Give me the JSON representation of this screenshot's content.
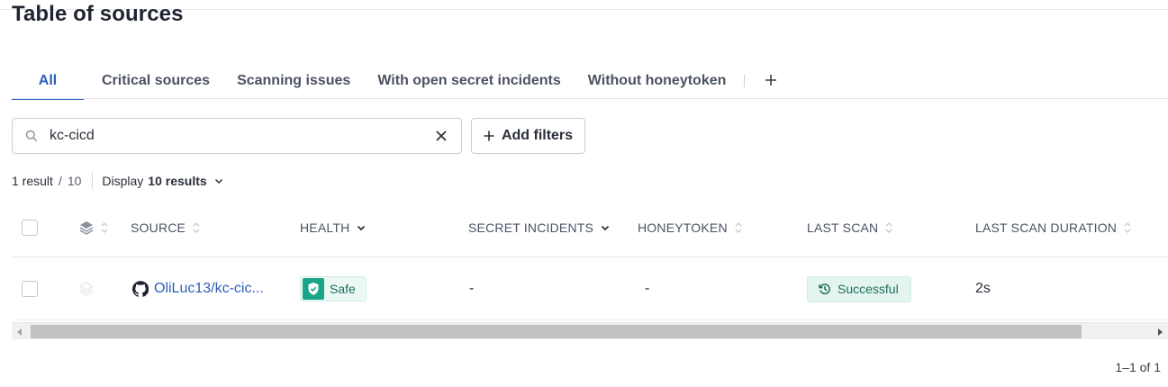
{
  "page": {
    "title": "Table of sources"
  },
  "tabs": [
    {
      "label": "All",
      "active": true
    },
    {
      "label": "Critical sources",
      "active": false
    },
    {
      "label": "Scanning issues",
      "active": false
    },
    {
      "label": "With open secret incidents",
      "active": false
    },
    {
      "label": "Without honeytoken",
      "active": false
    }
  ],
  "search": {
    "value": "kc-cicd",
    "placeholder": "Search"
  },
  "filters": {
    "add_label": "Add filters"
  },
  "results": {
    "count": "1 result",
    "separator": "/",
    "total": "10",
    "display_label": "Display",
    "display_value": "10 results"
  },
  "table": {
    "columns": [
      "SOURCE",
      "HEALTH",
      "SECRET INCIDENTS",
      "HONEYTOKEN",
      "LAST SCAN",
      "LAST SCAN DURATION"
    ],
    "rows": [
      {
        "source": "OliLuc13/kc-cic...",
        "health": "Safe",
        "secret_incidents": "-",
        "honeytoken": "-",
        "last_scan": "Successful",
        "last_scan_duration": "2s"
      }
    ]
  },
  "pagination": {
    "text": "1–1 of 1"
  },
  "colors": {
    "accent": "#2c5fb8",
    "safe": "#1aa588",
    "success_bg": "#e4f5ef"
  },
  "icons": [
    "search-icon",
    "close-icon",
    "plus-icon",
    "chevron-down-icon",
    "sort-icon",
    "layers-icon",
    "github-icon",
    "shield-icon",
    "history-icon"
  ]
}
